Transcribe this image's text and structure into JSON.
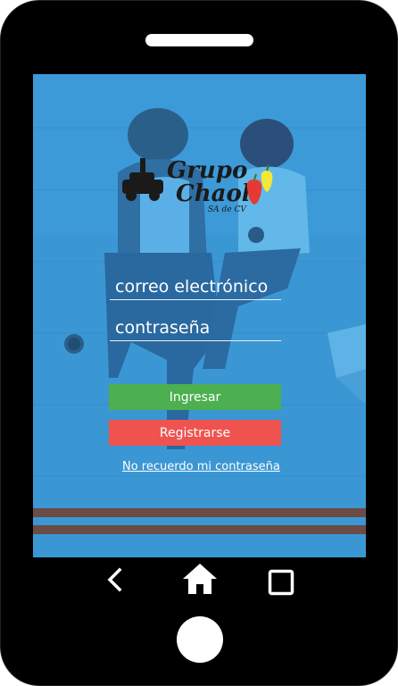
{
  "app": {
    "logo_text_line1": "Grupo",
    "logo_text_line2": "Chaol",
    "logo_subtitle": "SA de CV"
  },
  "login": {
    "email_placeholder": "correo electrónico",
    "password_placeholder": "contraseña",
    "login_button": "Ingresar",
    "register_button": "Registrarse",
    "forgot_link": "No recuerdo mi contraseña"
  },
  "colors": {
    "screen_overlay": "#3a97d4",
    "login_button": "#4caf50",
    "register_button": "#ef5350",
    "stripe": "#6b4b43"
  },
  "navbar": {
    "icons": [
      "back-icon",
      "home-icon",
      "recent-apps-icon"
    ]
  }
}
